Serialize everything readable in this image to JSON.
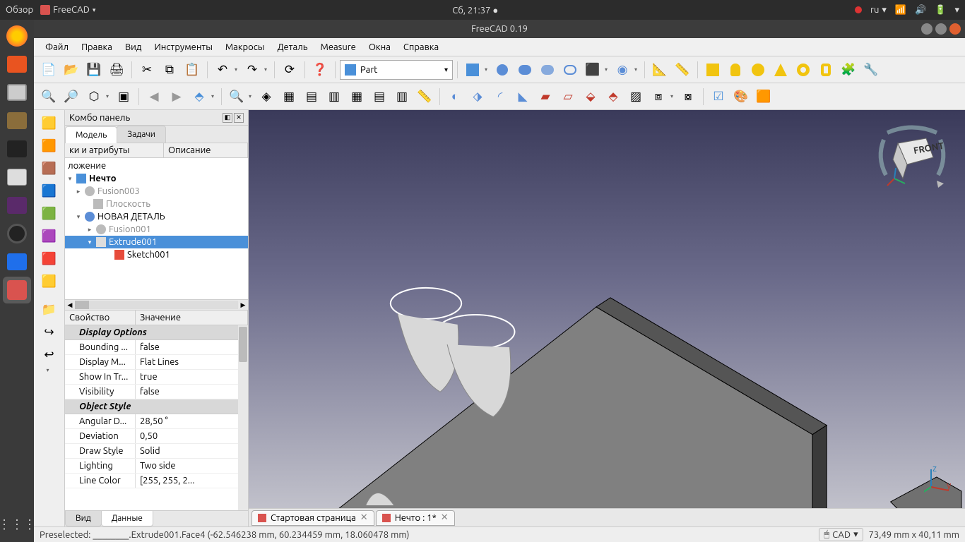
{
  "system": {
    "activities": "Обзор",
    "app_menu": "FreeCAD",
    "clock": "Сб, 21:37",
    "lang": "ru"
  },
  "window": {
    "title": "FreeCAD 0.19"
  },
  "menu": {
    "file": "Файл",
    "edit": "Правка",
    "view": "Вид",
    "tools": "Инструменты",
    "macros": "Макросы",
    "part": "Деталь",
    "measure": "Measure",
    "windows": "Окна",
    "help": "Справка"
  },
  "workbench": {
    "label": "Part"
  },
  "combo": {
    "title": "Комбо панель",
    "tabs": {
      "model": "Модель",
      "tasks": "Задачи"
    },
    "tree_headers": {
      "labels": "ки и атрибуты",
      "desc": "Описание"
    },
    "tree": {
      "app": "ложение",
      "doc": "Нечто",
      "items": [
        {
          "label": "Fusion003",
          "muted": true
        },
        {
          "label": "Плоскость",
          "muted": true
        },
        {
          "label": "НОВАЯ ДЕТАЛЬ",
          "muted": false
        },
        {
          "label": "Fusion001",
          "muted": true
        },
        {
          "label": "Extrude001",
          "selected": true
        },
        {
          "label": "Sketch001",
          "muted": false
        }
      ]
    },
    "props_headers": {
      "name": "Свойство",
      "value": "Значение"
    },
    "props": {
      "groups": [
        {
          "title": "Display Options",
          "rows": [
            {
              "name": "Bounding ...",
              "value": "false"
            },
            {
              "name": "Display M...",
              "value": "Flat Lines"
            },
            {
              "name": "Show In Tr...",
              "value": "true"
            },
            {
              "name": "Visibility",
              "value": "false"
            }
          ]
        },
        {
          "title": "Object Style",
          "rows": [
            {
              "name": "Angular D...",
              "value": "28,50 °"
            },
            {
              "name": "Deviation",
              "value": "0,50"
            },
            {
              "name": "Draw Style",
              "value": "Solid"
            },
            {
              "name": "Lighting",
              "value": "Two side"
            },
            {
              "name": "Line Color",
              "value": "[255, 255, 2..."
            }
          ]
        }
      ]
    },
    "bottom_tabs": {
      "view": "Вид",
      "data": "Данные"
    }
  },
  "doctabs": [
    {
      "label": "Стартовая страница"
    },
    {
      "label": "Нечто : 1*"
    }
  ],
  "navcube": {
    "face": "FRONT"
  },
  "status": {
    "preselected": "Preselected: ________.Extrude001.Face4 (-62.546238 mm, 60.234459 mm, 18.060478 mm)",
    "mode": "CAD",
    "dims": "73,49 mm x 40,11 mm"
  },
  "launcher_icons": [
    "firefox",
    "files",
    "screenshot",
    "terminal",
    "monitor",
    "calc",
    "obs-alt",
    "obs",
    "libreoffice",
    "freecad"
  ],
  "colors": {
    "firefox": "#ff7b2b",
    "files": "#e95420",
    "terminal": "#3c3c3c",
    "calc": "#4caf50",
    "freecad": "#d9534f",
    "obs": "#222",
    "screenshot": "#666",
    "monitor": "#333",
    "libreoffice": "#1f6feb",
    "obs-alt": "#5a2a6a"
  }
}
